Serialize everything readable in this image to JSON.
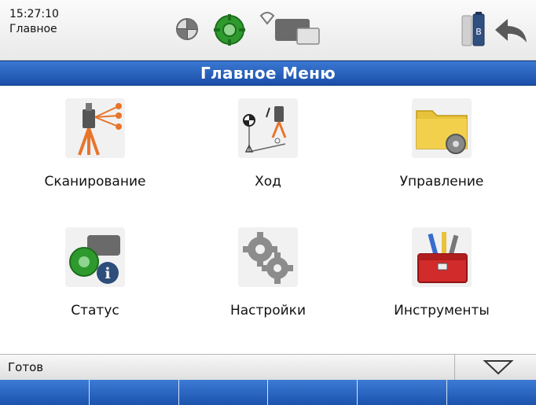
{
  "status": {
    "time": "15:27:10",
    "screen_name": "Главное"
  },
  "title": "Главное Меню",
  "menu": [
    {
      "label": "Сканирование",
      "icon": "scanning-icon"
    },
    {
      "label": "Ход",
      "icon": "traverse-icon"
    },
    {
      "label": "Управление",
      "icon": "management-icon"
    },
    {
      "label": "Статус",
      "icon": "status-icon"
    },
    {
      "label": "Настройки",
      "icon": "settings-icon"
    },
    {
      "label": "Инструменты",
      "icon": "tools-icon"
    }
  ],
  "bottom": {
    "status_text": "Готов"
  },
  "colors": {
    "title_bar": "#2a62bf",
    "softkey": "#2a62bf",
    "accent_orange": "#e8742a",
    "accent_green": "#2e9a2e"
  }
}
